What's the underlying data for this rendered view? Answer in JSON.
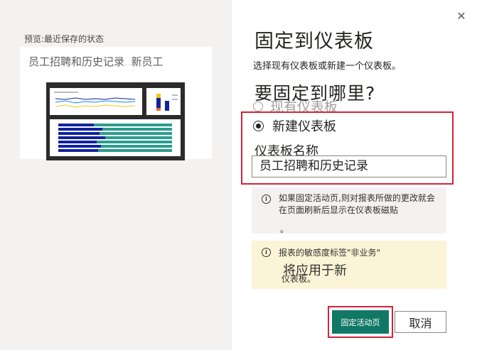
{
  "preview": {
    "label": "预览:最近保存的状态",
    "card_title": "员工招聘和历史记录..新员工"
  },
  "dialog": {
    "title": "固定到仪表板",
    "subtitle": "选择现有仪表板或新建一个仪表板。",
    "where_title": "要固定到哪里?",
    "option_existing": "现有仪表板",
    "option_new": "新建仪表板",
    "name_label": "仪表板名称",
    "name_value": "员工招聘和历史记录",
    "info_text": "如果固定活动页,则对报表所做的更改就会在页面刷新后显示在仪表板磁贴",
    "info_text_extra": "。",
    "warn_text": "报表的敏感度标签\"非业务\"",
    "warn_large": "将应用于新",
    "warn_small": "仪表板。",
    "primary_button": "固定活动页",
    "cancel_button": "取消",
    "close_icon": "close-icon",
    "accent_color": "#117865",
    "highlight_color": "#d6223a"
  }
}
